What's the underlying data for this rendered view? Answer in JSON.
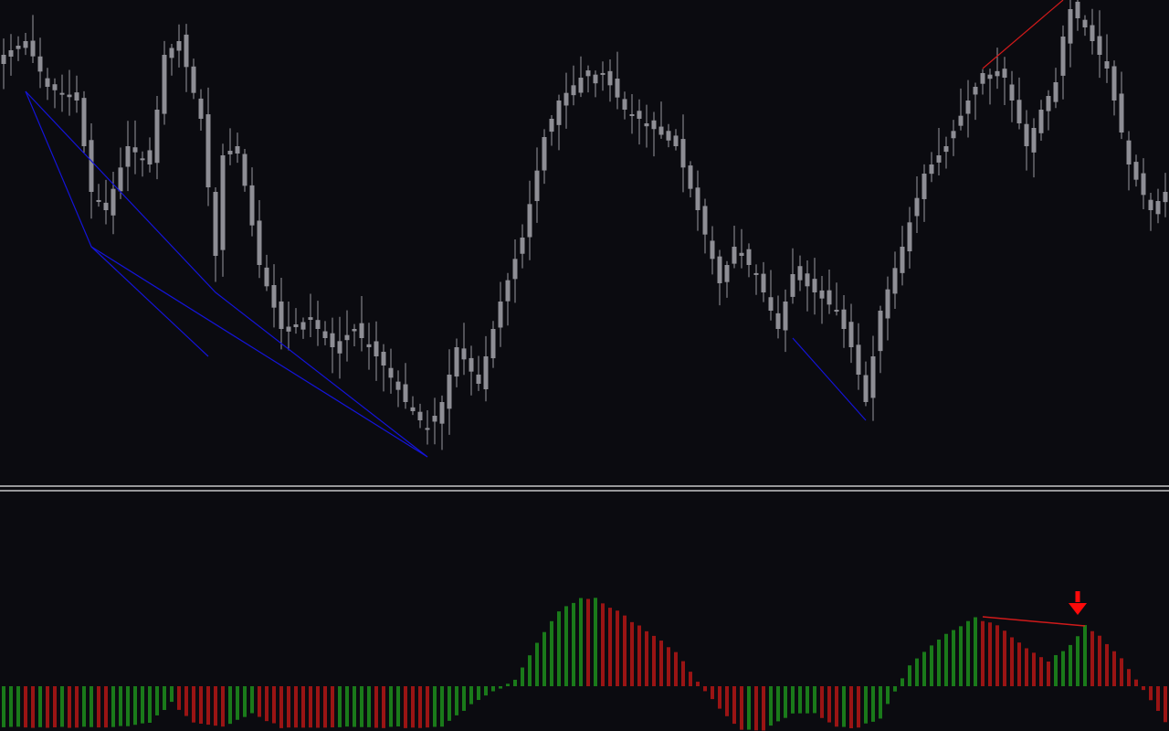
{
  "colors": {
    "background": "#0b0b10",
    "candle": "#8e8e95",
    "wick": "#9a9aa0",
    "separator": "#c8c8c8",
    "divergence_bull": "#1414d8",
    "divergence_bear": "#d01a1a",
    "hist_up": "#1a7a1a",
    "hist_down": "#9a1414",
    "signal_arrow": "#ff0a0a"
  },
  "chart_data": [
    {
      "type": "candlestick",
      "title": "",
      "xlabel": "",
      "ylabel": "",
      "grid": false,
      "legend": "none",
      "ylim": [
        0,
        520
      ],
      "x_count": 160,
      "anchors_close": [
        [
          0,
          60
        ],
        [
          3,
          45
        ],
        [
          6,
          95
        ],
        [
          10,
          110
        ],
        [
          12,
          210
        ],
        [
          14,
          230
        ],
        [
          17,
          160
        ],
        [
          20,
          180
        ],
        [
          22,
          60
        ],
        [
          24,
          45
        ],
        [
          27,
          130
        ],
        [
          29,
          280
        ],
        [
          30,
          170
        ],
        [
          32,
          160
        ],
        [
          35,
          290
        ],
        [
          38,
          360
        ],
        [
          42,
          350
        ],
        [
          45,
          380
        ],
        [
          48,
          360
        ],
        [
          52,
          400
        ],
        [
          55,
          440
        ],
        [
          58,
          470
        ],
        [
          60,
          440
        ],
        [
          62,
          380
        ],
        [
          65,
          420
        ],
        [
          68,
          330
        ],
        [
          71,
          260
        ],
        [
          74,
          150
        ],
        [
          76,
          110
        ],
        [
          79,
          85
        ],
        [
          82,
          80
        ],
        [
          85,
          120
        ],
        [
          88,
          135
        ],
        [
          92,
          160
        ],
        [
          95,
          230
        ],
        [
          98,
          310
        ],
        [
          100,
          270
        ],
        [
          103,
          300
        ],
        [
          106,
          360
        ],
        [
          108,
          300
        ],
        [
          111,
          320
        ],
        [
          114,
          340
        ],
        [
          116,
          380
        ],
        [
          118,
          440
        ],
        [
          120,
          340
        ],
        [
          123,
          270
        ],
        [
          126,
          190
        ],
        [
          129,
          160
        ],
        [
          132,
          110
        ],
        [
          134,
          80
        ],
        [
          137,
          85
        ],
        [
          140,
          160
        ],
        [
          142,
          120
        ],
        [
          144,
          90
        ],
        [
          145,
          40
        ],
        [
          146,
          10
        ],
        [
          148,
          30
        ],
        [
          151,
          75
        ],
        [
          154,
          180
        ],
        [
          157,
          230
        ],
        [
          159,
          210
        ]
      ],
      "divergence_lines": [
        {
          "color": "bull",
          "points": [
            [
              3,
              100
            ],
            [
              12,
              270
            ],
            [
              58,
              500
            ]
          ]
        },
        {
          "color": "bull",
          "points": [
            [
              3,
              100
            ],
            [
              29,
              320
            ],
            [
              58,
              500
            ]
          ]
        },
        {
          "color": "bull",
          "points": [
            [
              12,
              270
            ],
            [
              28,
              390
            ]
          ]
        },
        {
          "color": "bull",
          "points": [
            [
              108,
              370
            ],
            [
              118,
              460
            ]
          ]
        },
        {
          "color": "bear",
          "points": [
            [
              134,
              75
            ],
            [
              145,
              0
            ]
          ]
        }
      ]
    },
    {
      "type": "histogram",
      "title": "",
      "xlabel": "",
      "ylabel": "",
      "grid": false,
      "legend": "none",
      "ylim": [
        -50,
        100
      ],
      "x_count": 160,
      "anchors_value": [
        [
          0,
          -45
        ],
        [
          5,
          -45
        ],
        [
          10,
          -45
        ],
        [
          15,
          -45
        ],
        [
          20,
          -40
        ],
        [
          23,
          -18
        ],
        [
          26,
          -40
        ],
        [
          30,
          -45
        ],
        [
          34,
          -30
        ],
        [
          38,
          -45
        ],
        [
          43,
          -45
        ],
        [
          50,
          -45
        ],
        [
          55,
          -45
        ],
        [
          60,
          -45
        ],
        [
          64,
          -20
        ],
        [
          68,
          -2
        ],
        [
          70,
          8
        ],
        [
          73,
          48
        ],
        [
          76,
          82
        ],
        [
          79,
          97
        ],
        [
          81,
          96
        ],
        [
          84,
          82
        ],
        [
          88,
          60
        ],
        [
          92,
          38
        ],
        [
          95,
          5
        ],
        [
          98,
          -25
        ],
        [
          101,
          -48
        ],
        [
          104,
          -48
        ],
        [
          108,
          -30
        ],
        [
          111,
          -30
        ],
        [
          114,
          -45
        ],
        [
          117,
          -45
        ],
        [
          120,
          -35
        ],
        [
          122,
          -5
        ],
        [
          124,
          22
        ],
        [
          128,
          52
        ],
        [
          133,
          75
        ],
        [
          136,
          66
        ],
        [
          140,
          42
        ],
        [
          143,
          28
        ],
        [
          146,
          45
        ],
        [
          148,
          66
        ],
        [
          150,
          55
        ],
        [
          153,
          30
        ],
        [
          155,
          8
        ],
        [
          157,
          -15
        ],
        [
          159,
          -40
        ]
      ],
      "divergence_lines": [
        {
          "color": "bear",
          "points": [
            [
              134,
              76
            ],
            [
              148,
              66
            ]
          ]
        }
      ],
      "signals": [
        {
          "type": "sell-arrow",
          "x": 148
        }
      ]
    }
  ]
}
